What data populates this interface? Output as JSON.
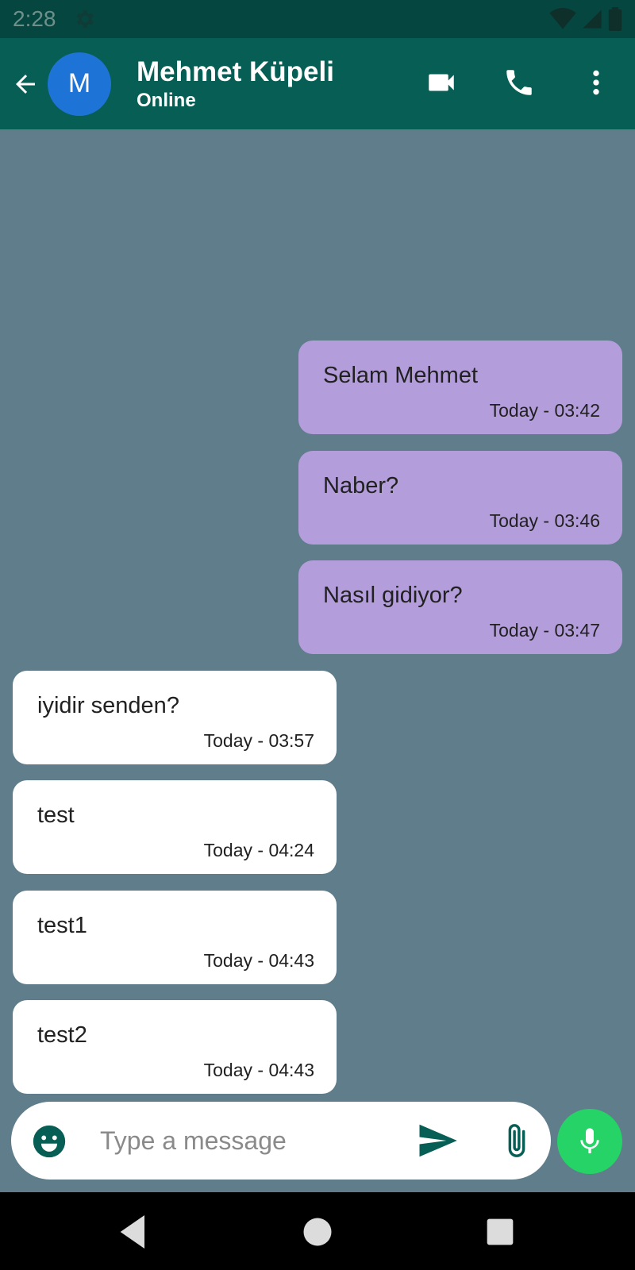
{
  "status_bar": {
    "time": "2:28",
    "icons": [
      "gear-icon",
      "wifi-icon",
      "cell-signal-icon",
      "battery-icon"
    ]
  },
  "header": {
    "avatar_initial": "M",
    "contact_name": "Mehmet Küpeli",
    "contact_status": "Online",
    "icons": [
      "back-arrow-icon",
      "video-call-icon",
      "phone-icon",
      "more-vert-icon"
    ],
    "colors": {
      "bar": "#075e54",
      "avatar": "#1e74d6"
    }
  },
  "messages": [
    {
      "direction": "sent",
      "text": "Selam Mehmet",
      "time": "Today - 03:42"
    },
    {
      "direction": "sent",
      "text": "Naber?",
      "time": "Today - 03:46"
    },
    {
      "direction": "sent",
      "text": "Nasıl gidiyor?",
      "time": "Today - 03:47"
    },
    {
      "direction": "received",
      "text": "iyidir senden?",
      "time": "Today - 03:57"
    },
    {
      "direction": "received",
      "text": "test",
      "time": "Today - 04:24"
    },
    {
      "direction": "received",
      "text": "test1",
      "time": "Today - 04:43"
    },
    {
      "direction": "received",
      "text": "test2",
      "time": "Today - 04:43"
    }
  ],
  "composer": {
    "placeholder": "Type a message",
    "value": "",
    "icons": [
      "emoji-icon",
      "send-icon",
      "attach-icon",
      "mic-icon"
    ],
    "colors": {
      "mic": "#25d366",
      "sent_bubble": "#b39ddb",
      "received_bubble": "#ffffff",
      "background": "#607d8b"
    }
  },
  "nav_bar": {
    "icons": [
      "nav-back-icon",
      "nav-home-icon",
      "nav-recents-icon"
    ]
  }
}
